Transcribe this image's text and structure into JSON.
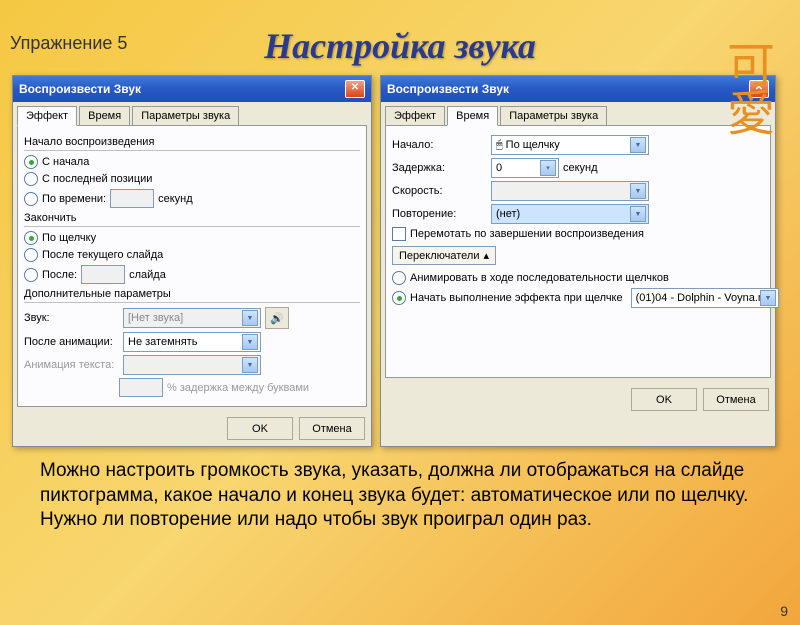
{
  "exercise": "Упражнение 5",
  "kanji": "可愛",
  "title": "Настройка звука",
  "pagenum": "9",
  "desc": "Можно настроить громкость звука, указать, должна ли отображаться на слайде пиктограмма, какое начало и конец звука будет: автоматическое или по щелчку. Нужно ли повторение или надо чтобы звук проиграл один раз.",
  "dlg1": {
    "title": "Воспроизвести Звук",
    "tabs": [
      "Эффект",
      "Время",
      "Параметры звука"
    ],
    "group_start": "Начало воспроизведения",
    "opt_start1": "С начала",
    "opt_start2": "С последней позиции",
    "opt_start3": "По времени:",
    "sec": "секунд",
    "group_end": "Закончить",
    "opt_end1": "По щелчку",
    "opt_end2": "После текущего слайда",
    "opt_end3": "После:",
    "slide": "слайда",
    "group_extra": "Дополнительные параметры",
    "lbl_sound": "Звук:",
    "val_sound": "[Нет звука]",
    "lbl_after": "После анимации:",
    "val_after": "Не затемнять",
    "lbl_textanim": "Анимация текста:",
    "lbl_delay": "% задержка между буквами",
    "ok": "OK",
    "cancel": "Отмена"
  },
  "dlg2": {
    "title": "Воспроизвести Звук",
    "tabs": [
      "Эффект",
      "Время",
      "Параметры звука"
    ],
    "lbl_start": "Начало:",
    "val_start": "По щелчку",
    "lbl_delay": "Задержка:",
    "val_delay": "0",
    "sec": "секунд",
    "lbl_speed": "Скорость:",
    "lbl_repeat": "Повторение:",
    "val_repeat": "(нет)",
    "chk_rewind": "Перемотать по завершении воспроизведения",
    "switchers": "Переключатели",
    "opt1": "Анимировать в ходе последовательности щелчков",
    "opt2": "Начать выполнение эффекта при щелчке",
    "val_trigger": "(01)04 - Dolphin - Voyna.m",
    "ok": "OK",
    "cancel": "Отмена"
  }
}
